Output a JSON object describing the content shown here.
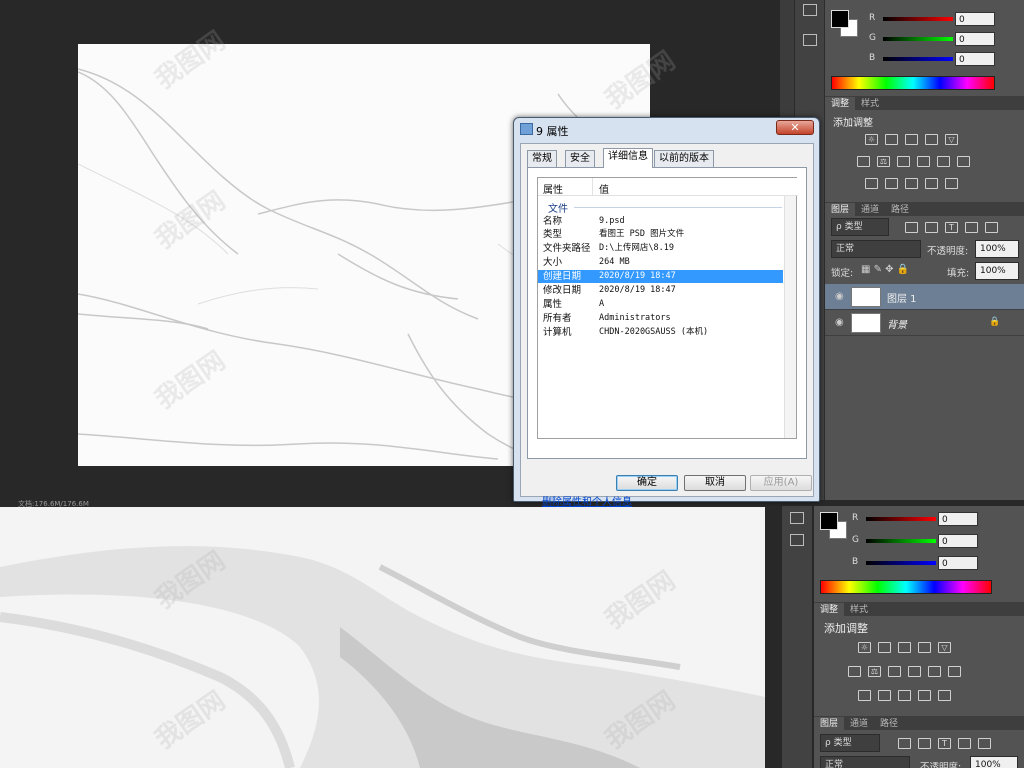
{
  "status_bar": "文档:176.6M/176.6M",
  "color_panel": {
    "channels": [
      {
        "label": "R",
        "value": "0",
        "color": "#c41c1c"
      },
      {
        "label": "G",
        "value": "0",
        "color": "#1c9e1c"
      },
      {
        "label": "B",
        "value": "0",
        "color": "#1c2ec4"
      }
    ]
  },
  "adjust_panel": {
    "tabs": [
      "调整",
      "样式"
    ],
    "title": "添加调整"
  },
  "layers_panel": {
    "tabs": [
      "图层",
      "通道",
      "路径"
    ],
    "filter": "ρ 类型",
    "blend_mode": "正常",
    "opacity_label": "不透明度:",
    "opacity_value": "100%",
    "lock_label": "锁定:",
    "fill_label": "填充:",
    "fill_value": "100%",
    "layers": [
      {
        "name": "图层 1"
      },
      {
        "name": "背景"
      }
    ]
  },
  "dialog": {
    "title": "9 属性",
    "close": "✕",
    "tabs": [
      "常规",
      "安全",
      "详细信息",
      "以前的版本"
    ],
    "header_property": "属性",
    "header_value": "值",
    "section": "文件",
    "rows": [
      {
        "k": "名称",
        "v": "9.psd"
      },
      {
        "k": "类型",
        "v": "看图王 PSD 图片文件"
      },
      {
        "k": "文件夹路径",
        "v": "D:\\上传网店\\8.19"
      },
      {
        "k": "大小",
        "v": "264 MB"
      },
      {
        "k": "创建日期",
        "v": "2020/8/19 18:47"
      },
      {
        "k": "修改日期",
        "v": "2020/8/19 18:47"
      },
      {
        "k": "属性",
        "v": "A"
      },
      {
        "k": "所有者",
        "v": "Administrators"
      },
      {
        "k": "计算机",
        "v": "CHDN-2020GSAUSS (本机)"
      }
    ],
    "remove_link": "删除属性和个人信息",
    "ok": "确定",
    "cancel": "取消",
    "apply": "应用(A)"
  }
}
